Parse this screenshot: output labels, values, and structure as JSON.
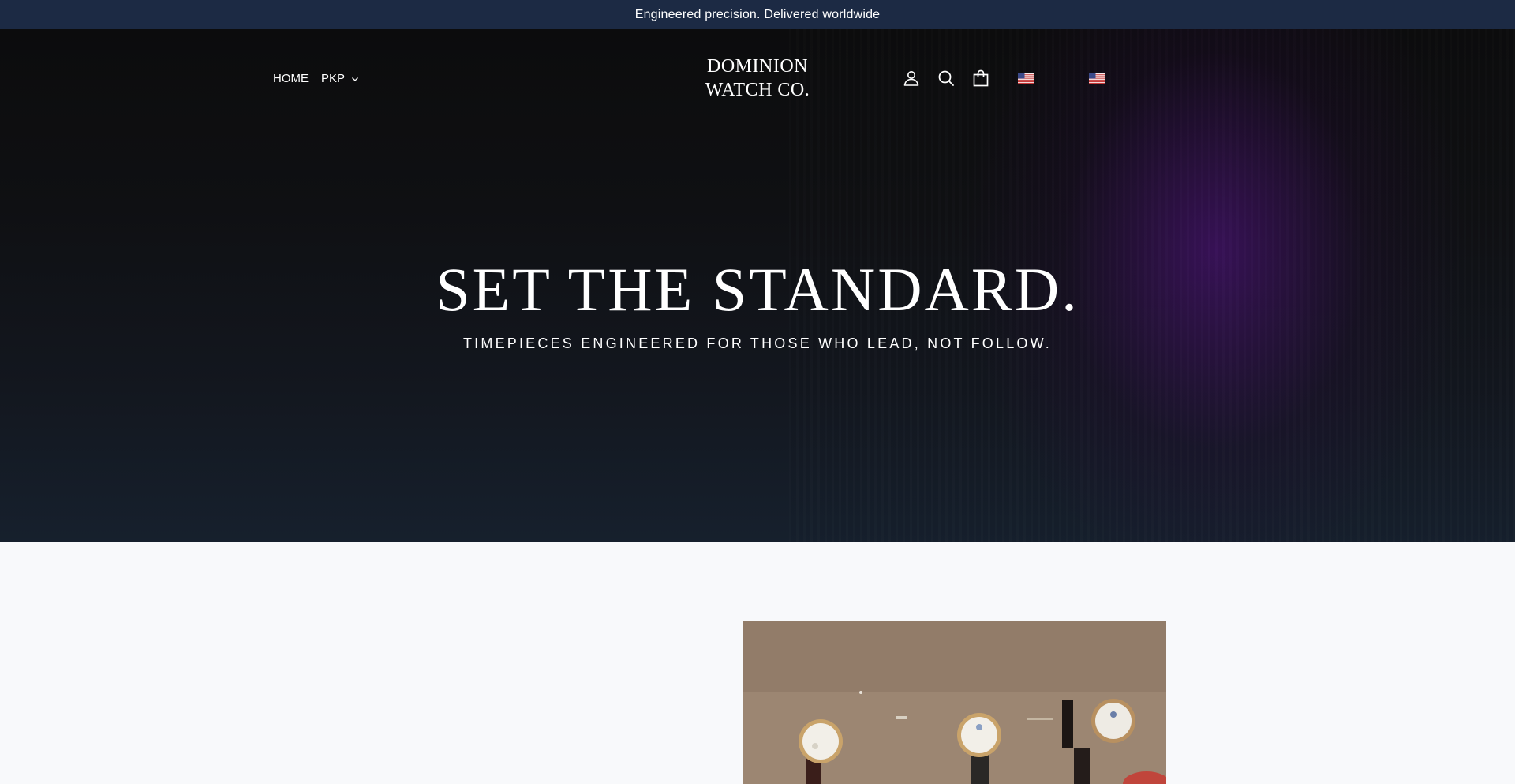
{
  "announcement": {
    "text": "Engineered precision. Delivered worldwide"
  },
  "nav": {
    "home_label": "HOME",
    "currency_label": "PKP"
  },
  "logo": {
    "line1": "DOMINION",
    "line2": "WATCH CO."
  },
  "header_icons": {
    "account": "user-icon",
    "search": "search-icon",
    "cart": "shopping-bag-icon",
    "flag_1": "us-flag-icon",
    "flag_2": "us-flag-icon"
  },
  "hero": {
    "title": "SET THE STANDARD.",
    "subtitle": "TIMEPIECES ENGINEERED FOR THOSE WHO LEAD, NOT FOLLOW."
  },
  "colors": {
    "announcement_bg": "#1c2a44",
    "hero_bg": "#0f1013",
    "hero_accent": "#46126e",
    "page_bg": "#f8f9fb"
  }
}
